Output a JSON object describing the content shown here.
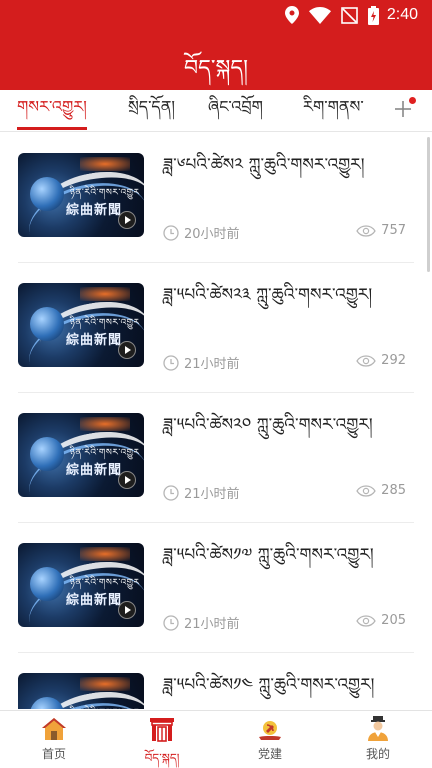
{
  "status_bar": {
    "time": "2:40",
    "icons": [
      "location-icon",
      "wifi-icon",
      "no-signal-icon",
      "battery-charging-icon"
    ]
  },
  "header": {
    "title": "བོད་སྐད།"
  },
  "tabs": [
    {
      "label": "གསར་འགྱུར།",
      "active": true
    },
    {
      "label": "སྲིད་དོན།",
      "active": false
    },
    {
      "label": "ཞིང་འབྲོག",
      "active": false
    },
    {
      "label": "རིག་གནས་",
      "active": false
    }
  ],
  "tab_add_icon": "plus-icon",
  "thumbnail": {
    "caption_top": "ཉིན་རེའི་གསར་འགྱུར",
    "caption_main": "綜曲新聞"
  },
  "articles": [
    {
      "title": "ཟླ་༦པའི་ཚེས༢ ཀླུ་ཆུའི་གསར་འགྱུར།",
      "time": "20小时前",
      "views": "757"
    },
    {
      "title": "ཟླ་༥པའི་ཚེས༢༣ ཀླུ་ཆུའི་གསར་འགྱུར།",
      "time": "21小时前",
      "views": "292"
    },
    {
      "title": "ཟླ་༥པའི་ཚེས༢༠ ཀླུ་ཆུའི་གསར་འགྱུར།",
      "time": "21小时前",
      "views": "285"
    },
    {
      "title": "ཟླ་༥པའི་ཚེས༡༧ ཀླུ་ཆུའི་གསར་འགྱུར།",
      "time": "21小时前",
      "views": "205"
    },
    {
      "title": "ཟླ་༥པའི་ཚེས༡༤ ཀླུ་ཆུའི་གསར་འགྱུར།",
      "time": "",
      "views": ""
    }
  ],
  "bottom_nav": [
    {
      "label": "首页",
      "icon": "home-icon",
      "active": false
    },
    {
      "label": "བོད་སྐད།",
      "icon": "gate-icon",
      "active": true
    },
    {
      "label": "党建",
      "icon": "party-emblem-icon",
      "active": false
    },
    {
      "label": "我的",
      "icon": "profile-icon",
      "active": false
    }
  ],
  "colors": {
    "brand_red": "#d41d1d",
    "meta_gray": "#9a9a9a",
    "tab_dot": "#e02020"
  }
}
